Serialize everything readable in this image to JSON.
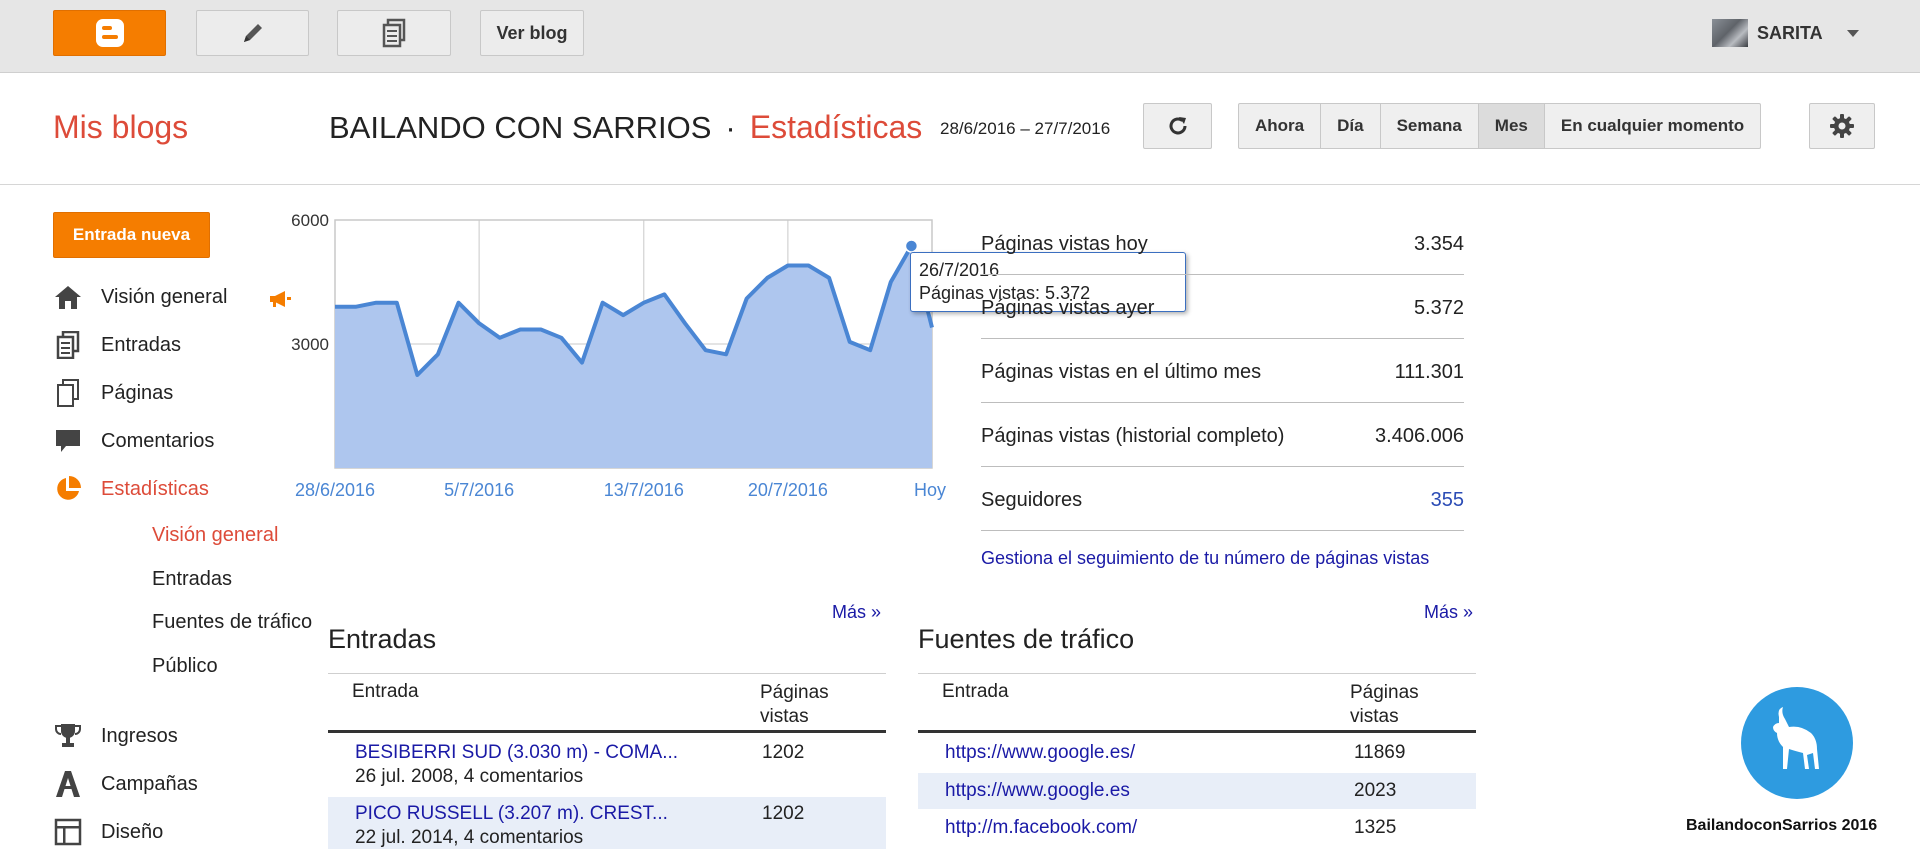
{
  "topbar": {
    "view_blog_label": "Ver blog",
    "user_name": "SARITA"
  },
  "header": {
    "my_blogs": "Mis blogs",
    "blog_title": "BAILANDO CON SARRIOS",
    "separator": "·",
    "section": "Estadísticas",
    "date_range": "28/6/2016 – 27/7/2016",
    "ranges": [
      "Ahora",
      "Día",
      "Semana",
      "Mes",
      "En cualquier momento"
    ],
    "active_range": "Mes"
  },
  "sidebar": {
    "new_post": "Entrada nueva",
    "items": [
      {
        "label": "Visión general",
        "icon": "home-icon"
      },
      {
        "label": "Entradas",
        "icon": "posts-icon"
      },
      {
        "label": "Páginas",
        "icon": "pages-icon"
      },
      {
        "label": "Comentarios",
        "icon": "comments-icon"
      },
      {
        "label": "Estadísticas",
        "icon": "stats-pie-icon"
      },
      {
        "label": "Ingresos",
        "icon": "trophy-icon"
      },
      {
        "label": "Campañas",
        "icon": "campaigns-icon"
      },
      {
        "label": "Diseño",
        "icon": "layout-icon"
      }
    ],
    "active_item": "Estadísticas",
    "subitems": [
      "Visión general",
      "Entradas",
      "Fuentes de tráfico",
      "Público"
    ],
    "active_subitem": "Visión general"
  },
  "chart_data": {
    "type": "area",
    "y_ticks": [
      "6000",
      "3000"
    ],
    "ylim": [
      0,
      6000
    ],
    "x_tick_labels": [
      "28/6/2016",
      "5/7/2016",
      "13/7/2016",
      "20/7/2016",
      "Hoy"
    ],
    "x_tick_index": [
      0,
      7,
      15,
      22,
      29
    ],
    "values": [
      3900,
      3900,
      4000,
      4000,
      2250,
      2750,
      4000,
      3500,
      3150,
      3350,
      3350,
      3150,
      2550,
      4000,
      3700,
      4000,
      4200,
      3500,
      2850,
      2750,
      4100,
      4600,
      4900,
      4900,
      4600,
      3050,
      2850,
      4500,
      5372,
      3400
    ],
    "highlight_index": 28,
    "colors": {
      "line": "#4a86d4",
      "fill": "#aec6ee",
      "grid": "#c9c9c9"
    }
  },
  "tooltip": {
    "date": "26/7/2016",
    "text": "Páginas vistas: 5.372"
  },
  "stats": [
    {
      "label": "Páginas vistas hoy",
      "value": "3.354"
    },
    {
      "label": "Páginas vistas ayer",
      "value": "5.372"
    },
    {
      "label": "Páginas vistas en el último mes",
      "value": "111.301"
    },
    {
      "label": "Páginas vistas (historial completo)",
      "value": "3.406.006"
    },
    {
      "label": "Seguidores",
      "value": "355"
    }
  ],
  "manage_link": "Gestiona el seguimiento de tu número de páginas vistas",
  "posts": {
    "more": "Más »",
    "title": "Entradas",
    "col1": "Entrada",
    "col2a": "Páginas",
    "col2b": "vistas",
    "rows": [
      {
        "title": "BESIBERRI SUD (3.030 m) - COMA...",
        "meta": "26 jul. 2008, 4 comentarios",
        "views": "1202"
      },
      {
        "title": "PICO RUSSELL (3.207 m). CREST...",
        "meta": "22 jul. 2014, 4 comentarios",
        "views": "1202"
      }
    ]
  },
  "traffic": {
    "more": "Más »",
    "title": "Fuentes de tráfico",
    "col1": "Entrada",
    "col2a": "Páginas",
    "col2b": "vistas",
    "rows": [
      {
        "url": "https://www.google.es/",
        "views": "11869"
      },
      {
        "url": "https://www.google.es",
        "views": "2023"
      },
      {
        "url": "http://m.facebook.com/",
        "views": "1325"
      }
    ]
  },
  "watermark": {
    "text": "BailandoconSarrios 2016"
  }
}
